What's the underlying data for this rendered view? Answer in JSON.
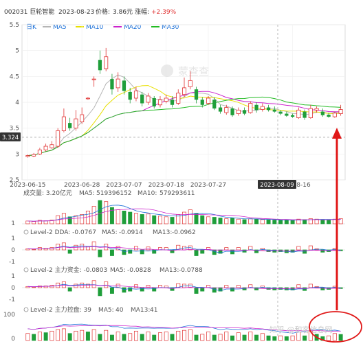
{
  "header": {
    "code_name": "002031 巨轮智能",
    "date": "2023-08-23",
    "price_label": "价格:",
    "price": "3.86元",
    "change_label": "涨幅:",
    "change": "+2.39%"
  },
  "legend": {
    "period": "日K",
    "items": [
      {
        "name": "MA5",
        "color": "#b5b5b5"
      },
      {
        "name": "MA10",
        "color": "#e8e000"
      },
      {
        "name": "MA20",
        "color": "#cc22cc"
      },
      {
        "name": "MA30",
        "color": "#22bb22"
      }
    ]
  },
  "watermark": "蒙查查",
  "footer_watermark": "知乎 @和客信息网",
  "hover_price_label": "3.324",
  "hover_date_label": "2023-08-09",
  "colors": {
    "up": "#e03030",
    "down": "#1f9e3a",
    "arrow": "#e01818"
  },
  "panels": {
    "volume": {
      "title": "成交量: 3.20亿元",
      "ma5_label": "MA5:",
      "ma5": "519396152",
      "ma10_label": "MA10:",
      "ma10": "579293611",
      "ytick": "1"
    },
    "dda": {
      "title": "Level-2  DDA: -0.0767",
      "ma5_label": "MA5:",
      "ma5": "-0.0914",
      "ma13_label": "MA13:",
      "ma13": "-0.0962",
      "yticks": [
        "1",
        "0",
        "-1"
      ]
    },
    "zlzj": {
      "title": "Level-2  主力资金: -0.0803",
      "ma5_label": "MA5:",
      "ma5": "-0.0828",
      "ma13_label": "MA13:",
      "ma13": "-0.0788",
      "yticks": [
        "1",
        "0",
        "-1"
      ]
    },
    "zlkp": {
      "title": "Level-2  主力控盘: 39",
      "ma5_label": "MA5:",
      "ma5": "40",
      "ma13_label": "MA13:",
      "ma13": "41",
      "yticks": [
        "100",
        "0"
      ]
    }
  },
  "chart_data": {
    "type": "candlestick",
    "y_ticks": [
      2.5,
      3,
      3.5,
      4,
      4.5,
      5,
      5.5
    ],
    "ylim": [
      2.5,
      5.5
    ],
    "x_tick_labels": [
      "2023-06-15",
      "2023-06-28",
      "2023-07-07",
      "2023-07-18",
      "2023-07-27",
      "2023-08-16"
    ],
    "x_tick_index": [
      0,
      9,
      16,
      23,
      30,
      44
    ],
    "candles": [
      {
        "o": 2.95,
        "c": 2.97,
        "h": 2.99,
        "l": 2.93
      },
      {
        "o": 2.96,
        "c": 2.99,
        "h": 3.02,
        "l": 2.94
      },
      {
        "o": 3.0,
        "c": 3.08,
        "h": 3.12,
        "l": 2.98
      },
      {
        "o": 3.08,
        "c": 3.15,
        "h": 3.2,
        "l": 3.05
      },
      {
        "o": 3.12,
        "c": 3.18,
        "h": 3.25,
        "l": 3.1
      },
      {
        "o": 3.15,
        "c": 3.45,
        "h": 3.5,
        "l": 3.12
      },
      {
        "o": 3.45,
        "c": 3.72,
        "h": 3.88,
        "l": 3.42
      },
      {
        "o": 3.6,
        "c": 3.5,
        "h": 3.7,
        "l": 3.45
      },
      {
        "o": 3.5,
        "c": 3.68,
        "h": 3.85,
        "l": 3.45
      },
      {
        "o": 3.62,
        "c": 3.76,
        "h": 3.9,
        "l": 3.58
      },
      {
        "o": 4.08,
        "c": 4.08,
        "h": 4.1,
        "l": 4.05
      },
      {
        "o": 4.45,
        "c": 4.45,
        "h": 4.5,
        "l": 4.3
      },
      {
        "o": 4.82,
        "c": 4.62,
        "h": 5.0,
        "l": 4.55
      },
      {
        "o": 4.65,
        "c": 4.88,
        "h": 5.05,
        "l": 4.6
      },
      {
        "o": 4.45,
        "c": 4.25,
        "h": 4.55,
        "l": 4.15
      },
      {
        "o": 4.28,
        "c": 4.45,
        "h": 4.58,
        "l": 4.2
      },
      {
        "o": 4.42,
        "c": 4.22,
        "h": 4.5,
        "l": 4.15
      },
      {
        "o": 4.2,
        "c": 4.05,
        "h": 4.28,
        "l": 3.98
      },
      {
        "o": 4.08,
        "c": 4.22,
        "h": 4.3,
        "l": 4.02
      },
      {
        "o": 4.15,
        "c": 3.98,
        "h": 4.2,
        "l": 3.92
      },
      {
        "o": 4.0,
        "c": 4.12,
        "h": 4.18,
        "l": 3.95
      },
      {
        "o": 4.08,
        "c": 3.92,
        "h": 4.12,
        "l": 3.88
      },
      {
        "o": 3.95,
        "c": 4.05,
        "h": 4.12,
        "l": 3.9
      },
      {
        "o": 4.02,
        "c": 4.08,
        "h": 4.15,
        "l": 3.98
      },
      {
        "o": 4.05,
        "c": 3.95,
        "h": 4.12,
        "l": 3.9
      },
      {
        "o": 3.98,
        "c": 4.18,
        "h": 4.25,
        "l": 3.95
      },
      {
        "o": 4.15,
        "c": 4.28,
        "h": 4.48,
        "l": 4.1
      },
      {
        "o": 4.3,
        "c": 4.42,
        "h": 4.6,
        "l": 4.25
      },
      {
        "o": 4.25,
        "c": 4.05,
        "h": 4.3,
        "l": 3.98
      },
      {
        "o": 4.05,
        "c": 3.95,
        "h": 4.1,
        "l": 3.9
      },
      {
        "o": 3.98,
        "c": 4.08,
        "h": 4.12,
        "l": 3.95
      },
      {
        "o": 4.05,
        "c": 3.88,
        "h": 4.1,
        "l": 3.85
      },
      {
        "o": 3.9,
        "c": 3.82,
        "h": 3.95,
        "l": 3.78
      },
      {
        "o": 3.8,
        "c": 3.9,
        "h": 3.95,
        "l": 3.76
      },
      {
        "o": 3.88,
        "c": 3.75,
        "h": 3.92,
        "l": 3.72
      },
      {
        "o": 3.78,
        "c": 3.85,
        "h": 3.9,
        "l": 3.74
      },
      {
        "o": 3.85,
        "c": 3.78,
        "h": 3.9,
        "l": 3.75
      },
      {
        "o": 3.8,
        "c": 3.98,
        "h": 4.02,
        "l": 3.78
      },
      {
        "o": 3.95,
        "c": 3.85,
        "h": 4.0,
        "l": 3.8
      },
      {
        "o": 3.86,
        "c": 3.92,
        "h": 3.98,
        "l": 3.82
      },
      {
        "o": 3.9,
        "c": 3.85,
        "h": 3.95,
        "l": 3.82
      },
      {
        "o": 3.86,
        "c": 3.82,
        "h": 3.92,
        "l": 3.8
      },
      {
        "o": 3.82,
        "c": 3.78,
        "h": 3.85,
        "l": 3.75
      },
      {
        "o": 3.78,
        "c": 3.74,
        "h": 3.82,
        "l": 3.72
      },
      {
        "o": 3.75,
        "c": 3.72,
        "h": 3.78,
        "l": 3.7
      },
      {
        "o": 3.7,
        "c": 3.85,
        "h": 3.9,
        "l": 3.68
      },
      {
        "o": 3.82,
        "c": 3.7,
        "h": 3.86,
        "l": 3.66
      },
      {
        "o": 3.7,
        "c": 3.88,
        "h": 3.95,
        "l": 3.68
      },
      {
        "o": 3.85,
        "c": 3.88,
        "h": 3.92,
        "l": 3.8
      },
      {
        "o": 3.82,
        "c": 3.75,
        "h": 3.88,
        "l": 3.72
      },
      {
        "o": 3.76,
        "c": 3.72,
        "h": 3.8,
        "l": 3.7
      },
      {
        "o": 3.72,
        "c": 3.79,
        "h": 3.82,
        "l": 3.7
      },
      {
        "o": 3.78,
        "c": 3.86,
        "h": 3.95,
        "l": 3.74
      }
    ],
    "volume": [
      0.12,
      0.1,
      0.15,
      0.13,
      0.16,
      0.35,
      0.45,
      0.3,
      0.35,
      0.4,
      0.55,
      0.75,
      1.0,
      0.95,
      0.7,
      0.6,
      0.55,
      0.5,
      0.45,
      0.4,
      0.42,
      0.35,
      0.33,
      0.3,
      0.28,
      0.4,
      0.5,
      0.6,
      0.45,
      0.35,
      0.3,
      0.28,
      0.25,
      0.22,
      0.24,
      0.2,
      0.18,
      0.22,
      0.2,
      0.18,
      0.17,
      0.16,
      0.15,
      0.16,
      0.14,
      0.2,
      0.18,
      0.22,
      0.2,
      0.16,
      0.18,
      0.2,
      0.22
    ],
    "dda": [
      0.1,
      0.05,
      0.2,
      0.15,
      0.2,
      0.5,
      0.6,
      -0.3,
      0.4,
      0.5,
      0.3,
      0.7,
      -0.6,
      0.5,
      -0.5,
      0.3,
      -0.4,
      -0.3,
      0.3,
      -0.35,
      0.25,
      -0.3,
      0.2,
      0.2,
      -0.25,
      0.4,
      0.3,
      0.35,
      -0.5,
      -0.3,
      0.2,
      -0.4,
      -0.3,
      0.2,
      -0.35,
      0.2,
      -0.2,
      0.3,
      -0.25,
      0.15,
      -0.15,
      -0.2,
      -0.15,
      -0.25,
      -0.2,
      0.3,
      -0.3,
      0.35,
      0.1,
      -0.2,
      -0.15,
      0.15,
      -0.08
    ],
    "zlzj": [
      0.1,
      0.05,
      0.15,
      0.15,
      0.2,
      0.4,
      0.5,
      -0.3,
      0.3,
      0.4,
      0.3,
      0.6,
      -0.7,
      0.5,
      -0.5,
      0.3,
      -0.4,
      -0.3,
      0.25,
      -0.3,
      0.2,
      -0.3,
      0.2,
      0.15,
      -0.25,
      0.35,
      0.3,
      0.3,
      -0.5,
      -0.3,
      0.2,
      -0.4,
      -0.3,
      0.2,
      -0.3,
      0.2,
      -0.2,
      0.25,
      -0.2,
      0.15,
      -0.15,
      -0.2,
      -0.15,
      -0.2,
      -0.2,
      0.25,
      -0.25,
      0.3,
      0.1,
      -0.2,
      -0.15,
      0.12,
      -0.08
    ],
    "zlkp": [
      45,
      40,
      55,
      50,
      60,
      70,
      75,
      45,
      60,
      65,
      55,
      70,
      40,
      65,
      35,
      55,
      40,
      45,
      60,
      40,
      55,
      35,
      50,
      55,
      40,
      60,
      65,
      70,
      35,
      40,
      55,
      35,
      40,
      55,
      30,
      50,
      35,
      55,
      35,
      45,
      30,
      25,
      30,
      25,
      30,
      55,
      30,
      60,
      40,
      25,
      30,
      45,
      39
    ]
  }
}
